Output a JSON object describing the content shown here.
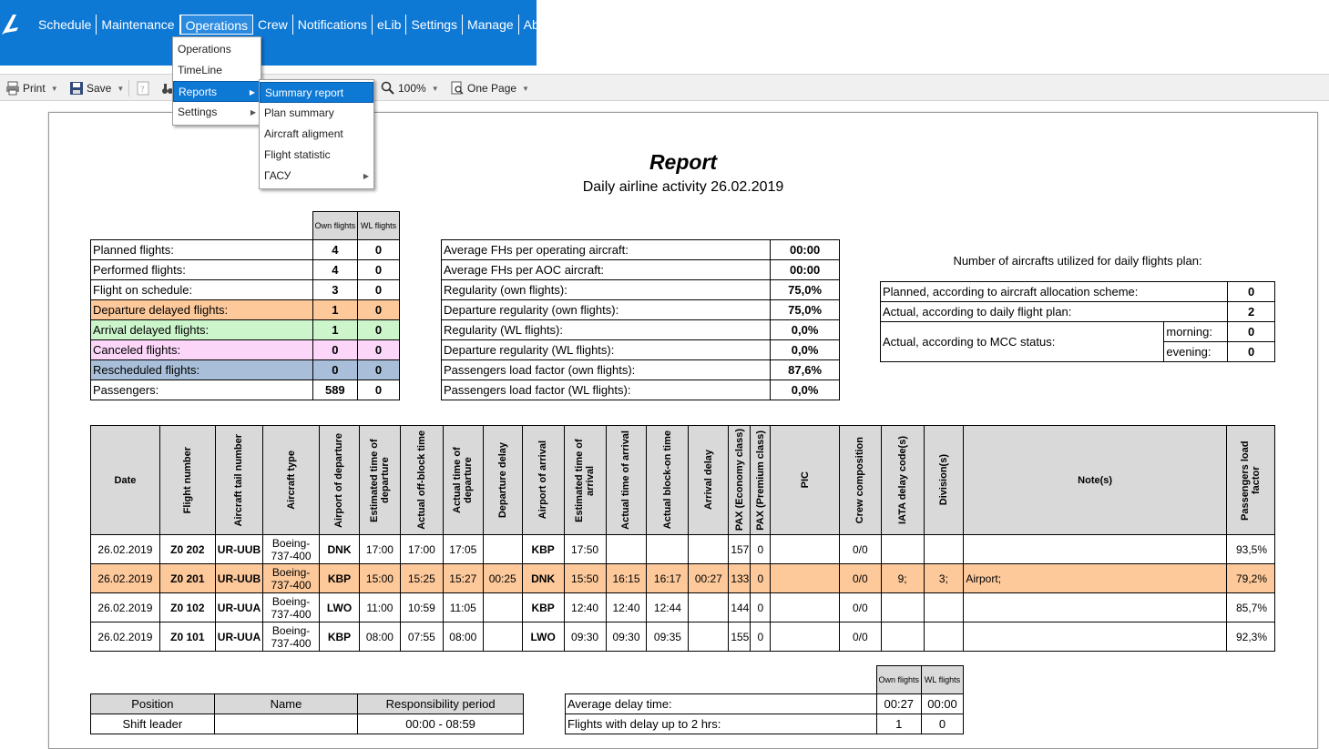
{
  "nav": {
    "items": [
      "Schedule",
      "Maintenance",
      "Operations",
      "Crew",
      "Notifications",
      "eLib",
      "Settings",
      "Manage",
      "About"
    ],
    "active": "Operations"
  },
  "toolbar": {
    "print": "Print",
    "save": "Save",
    "zoom": "100%",
    "page_mode": "One Page"
  },
  "menu_operations": {
    "items": [
      "Operations",
      "TimeLine",
      "Reports",
      "Settings"
    ],
    "selected": "Reports"
  },
  "menu_reports": {
    "items": [
      "Summary report",
      "Plan summary",
      "Aircraft aligment",
      "Flight statistic",
      "ГАСУ"
    ],
    "selected": "Summary report"
  },
  "report": {
    "title": "Report",
    "subtitle": "Daily airline activity 26.02.2019"
  },
  "summary": {
    "headers": [
      "Own flights",
      "WL flights"
    ],
    "rows": [
      {
        "label": "Planned flights:",
        "own": "4",
        "wl": "0"
      },
      {
        "label": "Performed flights:",
        "own": "4",
        "wl": "0"
      },
      {
        "label": "Flight on schedule:",
        "own": "3",
        "wl": "0"
      },
      {
        "label": "Departure delayed flights:",
        "own": "1",
        "wl": "0"
      },
      {
        "label": "Arrival delayed flights:",
        "own": "1",
        "wl": "0"
      },
      {
        "label": "Canceled flights:",
        "own": "0",
        "wl": "0"
      },
      {
        "label": "Rescheduled flights:",
        "own": "0",
        "wl": "0"
      },
      {
        "label": "Passengers:",
        "own": "589",
        "wl": "0"
      }
    ]
  },
  "metrics": [
    {
      "label": "Average FHs per operating aircraft:",
      "value": "00:00"
    },
    {
      "label": "Average FHs per AOC aircraft:",
      "value": "00:00"
    },
    {
      "label": "Regularity (own flights):",
      "value": "75,0%"
    },
    {
      "label": "Departure regularity (own flights):",
      "value": "75,0%"
    },
    {
      "label": "Regularity (WL flights):",
      "value": "0,0%"
    },
    {
      "label": "Departure regularity (WL flights):",
      "value": "0,0%"
    },
    {
      "label": "Passengers load factor (own flights):",
      "value": "87,6%"
    },
    {
      "label": "Passengers load factor (WL flights):",
      "value": "0,0%"
    }
  ],
  "aircraft_util": {
    "heading": "Number of aircrafts utilized for daily flights plan:",
    "planned_label": "Planned, according to aircraft allocation scheme:",
    "planned_value": "0",
    "actual_label": "Actual, according to daily flight plan:",
    "actual_value": "2",
    "mcc_label": "Actual, according to MCC status:",
    "morning_label": "morning:",
    "morning_value": "0",
    "evening_label": "evening:",
    "evening_value": "0"
  },
  "flights": {
    "headers": [
      "Date",
      "Flight number",
      "Aircraft tail number",
      "Aircraft type",
      "Airport of departure",
      "Estimated time of departure",
      "Actual off-block time",
      "Actual time of departure",
      "Departure delay",
      "Airport of arrival",
      "Estimated time of arrival",
      "Actual time of arrival",
      "Actual block-on time",
      "Arrival delay",
      "PAX (Economy class)",
      "PAX (Premium class)",
      "PIC",
      "Crew composition",
      "IATA delay code(s)",
      "Division(s)",
      "Note(s)",
      "Passengers load factor"
    ],
    "rows": [
      [
        "26.02.2019",
        "Z0 202",
        "UR-UUB",
        "Boeing-737-400",
        "DNK",
        "17:00",
        "17:00",
        "17:05",
        "",
        "KBP",
        "17:50",
        "",
        "",
        "",
        "157",
        "0",
        "",
        "0/0",
        "",
        "",
        "",
        "93,5%"
      ],
      [
        "26.02.2019",
        "Z0 201",
        "UR-UUB",
        "Boeing-737-400",
        "KBP",
        "15:00",
        "15:25",
        "15:27",
        "00:25",
        "DNK",
        "15:50",
        "16:15",
        "16:17",
        "00:27",
        "133",
        "0",
        "",
        "0/0",
        "9;",
        "3;",
        "Airport;",
        "79,2%"
      ],
      [
        "26.02.2019",
        "Z0 102",
        "UR-UUA",
        "Boeing-737-400",
        "LWO",
        "11:00",
        "10:59",
        "11:05",
        "",
        "KBP",
        "12:40",
        "12:40",
        "12:44",
        "",
        "144",
        "0",
        "",
        "0/0",
        "",
        "",
        "",
        "85,7%"
      ],
      [
        "26.02.2019",
        "Z0 101",
        "UR-UUA",
        "Boeing-737-400",
        "KBP",
        "08:00",
        "07:55",
        "08:00",
        "",
        "LWO",
        "09:30",
        "09:30",
        "09:35",
        "",
        "155",
        "0",
        "",
        "0/0",
        "",
        "",
        "",
        "92,3%"
      ]
    ]
  },
  "shift": {
    "headers": [
      "Position",
      "Name",
      "Responsibility period"
    ],
    "row": [
      "Shift leader",
      "",
      "00:00 - 08:59"
    ]
  },
  "delays": {
    "headers": [
      "Own flights",
      "WL flights"
    ],
    "rows": [
      {
        "label": "Average delay time:",
        "own": "00:27",
        "wl": "00:00"
      },
      {
        "label": "Flights with delay up to 2 hrs:",
        "own": "1",
        "wl": "0"
      }
    ]
  }
}
